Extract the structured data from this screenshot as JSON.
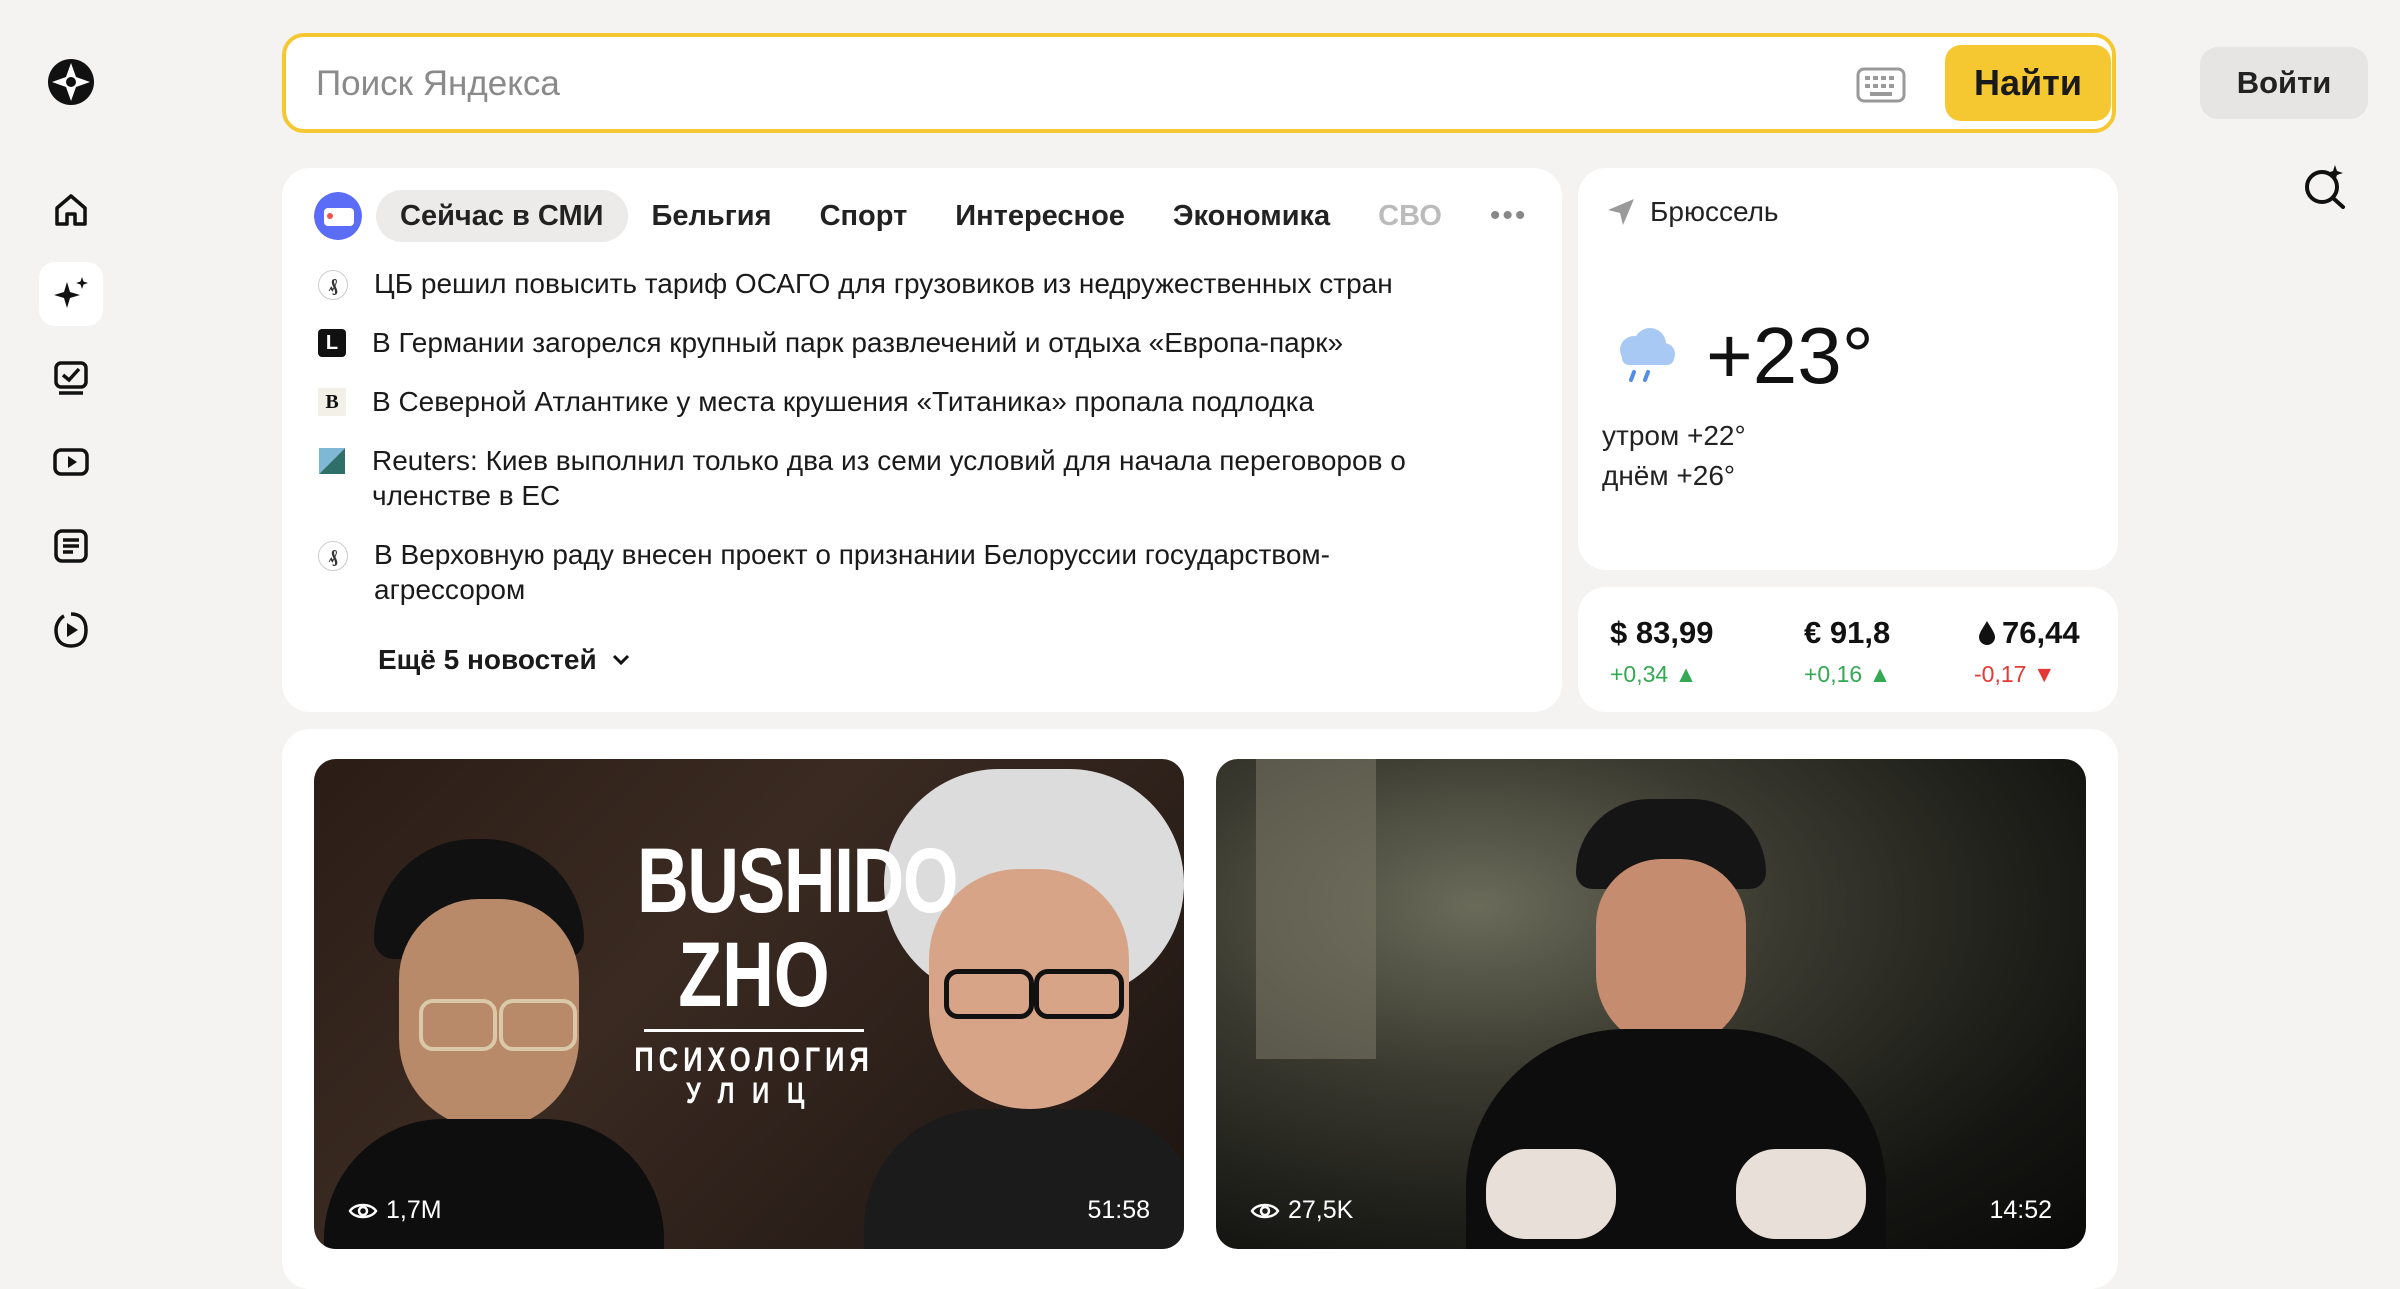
{
  "search": {
    "placeholder": "Поиск Яндекса",
    "find_label": "Найти"
  },
  "header": {
    "login_label": "Войти"
  },
  "sidebar": {
    "items": [
      {
        "icon": "yandex-logo-icon"
      },
      {
        "icon": "home-icon"
      },
      {
        "icon": "sparkle-icon"
      },
      {
        "icon": "tasks-icon"
      },
      {
        "icon": "video-icon"
      },
      {
        "icon": "article-icon"
      },
      {
        "icon": "play-circle-icon"
      }
    ]
  },
  "news": {
    "tabs": [
      {
        "label": "Сейчас в СМИ",
        "active": true
      },
      {
        "label": "Бельгия"
      },
      {
        "label": "Спорт"
      },
      {
        "label": "Интересное"
      },
      {
        "label": "Экономика"
      },
      {
        "label": "СВО"
      }
    ],
    "items": [
      {
        "source_mark": "₰",
        "text": "ЦБ решил повысить тариф ОСАГО для грузовиков из недружественных стран"
      },
      {
        "source_mark": "L",
        "text": "В Германии загорелся крупный парк развлечений и отдыха «Европа-парк»"
      },
      {
        "source_mark": "B",
        "text": "В Северной Атлантике у места крушения «Титаника» пропала подлодка"
      },
      {
        "source_mark": "",
        "text": "Reuters: Киев выполнил только два из семи условий для начала переговоров о членстве в ЕС"
      },
      {
        "source_mark": "₰",
        "text": "В Верховную раду внесен проект о признании Белоруссии государством-агрессором"
      }
    ],
    "more_label": "Ещё 5 новостей"
  },
  "weather": {
    "city": "Брюссель",
    "temp": "+23°",
    "morning": "утром +22°",
    "day": "днём +26°"
  },
  "rates": [
    {
      "value": "$ 83,99",
      "change": "+0,34 ▲",
      "direction": "up"
    },
    {
      "value": "€ 91,8",
      "change": "+0,16 ▲",
      "direction": "up"
    },
    {
      "value": "76,44",
      "change": "-0,17 ▼",
      "direction": "down"
    }
  ],
  "videos": [
    {
      "title_line1": "BUSHIDO",
      "title_line2": "ZHO",
      "subtitle1": "ПСИХОЛОГИЯ",
      "subtitle2": "УЛИЦ",
      "views": "1,7M",
      "duration": "51:58"
    },
    {
      "views": "27,5K",
      "duration": "14:52"
    }
  ],
  "colors": {
    "accent": "#f5c832",
    "up": "#34a853",
    "down": "#e53935",
    "page_bg": "#f4f3f2"
  }
}
